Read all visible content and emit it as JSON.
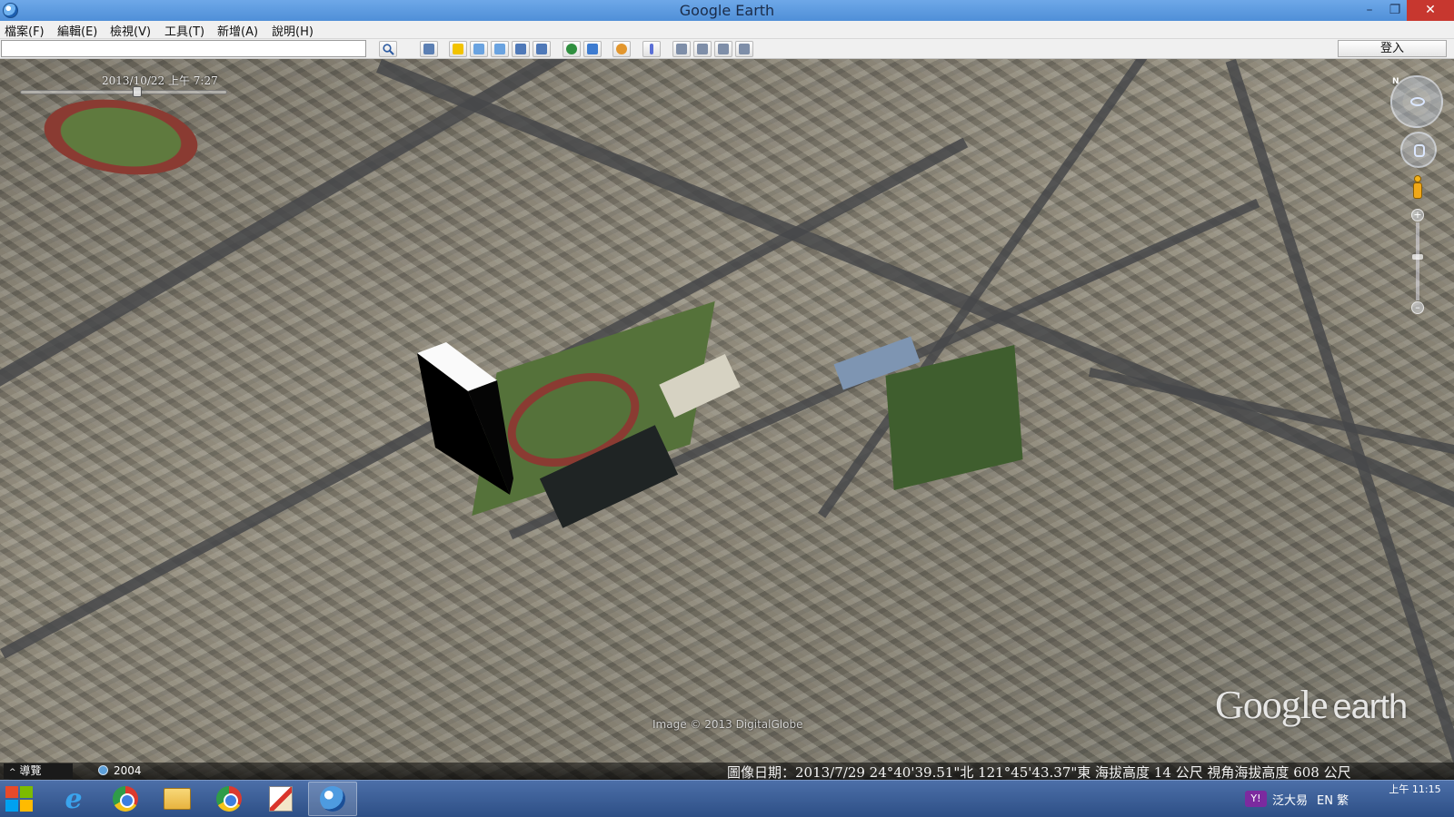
{
  "window": {
    "title": "Google Earth",
    "controls": {
      "minimize": "–",
      "maximize": "❐",
      "close": "✕"
    }
  },
  "menu": {
    "items": [
      "檔案(F)",
      "編輯(E)",
      "檢視(V)",
      "工具(T)",
      "新增(A)",
      "說明(H)"
    ]
  },
  "toolbar": {
    "search_value": "",
    "search_icon": "magnifier-icon",
    "buttons": [
      {
        "name": "sidebar-toggle",
        "color": "#5b7fb3"
      },
      {
        "name": "add-placemark",
        "color": "#f2c300"
      },
      {
        "name": "add-polygon",
        "color": "#6aa3e0"
      },
      {
        "name": "add-path",
        "color": "#6aa3e0"
      },
      {
        "name": "add-image-overlay",
        "color": "#4f79b8"
      },
      {
        "name": "record-tour",
        "color": "#4f79b8"
      },
      {
        "name": "historical-imagery",
        "color": "#2f8f3f"
      },
      {
        "name": "sunlight",
        "color": "#3d7bd0"
      },
      {
        "name": "switch-planet",
        "color": "#e2962d"
      },
      {
        "name": "ruler",
        "color": "#5a6fd6"
      },
      {
        "name": "email",
        "color": "#7e8ea8"
      },
      {
        "name": "print",
        "color": "#7e8ea8"
      },
      {
        "name": "save-image",
        "color": "#7e8ea8"
      },
      {
        "name": "view-in-maps",
        "color": "#7e8ea8"
      }
    ],
    "signin_label": "登入"
  },
  "timeline": {
    "label": "2013/10/22 上午 7:27",
    "position": 0.57
  },
  "map": {
    "imagery_credit": "Image © 2013 DigitalGlobe",
    "logo_google": "Google",
    "logo_earth": "earth",
    "north_label": "N"
  },
  "statusbar": {
    "tour_guide_label": "導覽",
    "tour_guide_caret": "^",
    "history_year": "2004",
    "readout": "圖像日期：2013/7/29    24°40'39.51\"北  121°45'43.37\"東  海拔高度    14 公尺   視角海拔高度    608 公尺"
  },
  "taskbar": {
    "apps": [
      {
        "name": "internet-explorer",
        "label": "e",
        "active": false
      },
      {
        "name": "google-chrome",
        "active": false
      },
      {
        "name": "file-explorer",
        "active": false
      },
      {
        "name": "google-chrome-2",
        "active": false
      },
      {
        "name": "paint",
        "active": false
      },
      {
        "name": "google-earth",
        "active": true
      }
    ],
    "ime_badge": "Y!",
    "ime_label": "泛大易",
    "lang_label": "EN 繁",
    "clock_time": "上午 11:15"
  }
}
